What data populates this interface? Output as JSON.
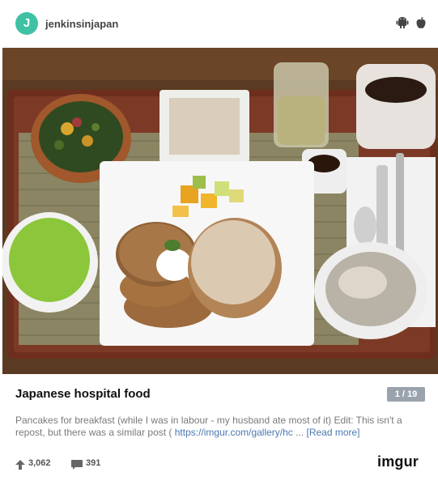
{
  "header": {
    "avatar_letter": "J",
    "username": "jenkinsinjapan",
    "platform_icons": [
      "android-icon",
      "apple-icon"
    ]
  },
  "post": {
    "title": "Japanese hospital food",
    "counter": "1 / 19",
    "description_text": "Pancakes for breakfast (while I was in labour - my husband ate most of it) Edit: This isn't a repost, but there was a similar post ( ",
    "description_link": "https://imgur.com/gallery/hc",
    "description_ellipsis": " ... ",
    "read_more": "[Read more]"
  },
  "footer": {
    "upvotes": "3,062",
    "comments": "391",
    "logo": "imgur"
  },
  "colors": {
    "avatar": "#3fc1a4",
    "counter_badge": "#9aa3ad",
    "link": "#4a78b0",
    "brand_green": "#1bb76e"
  }
}
